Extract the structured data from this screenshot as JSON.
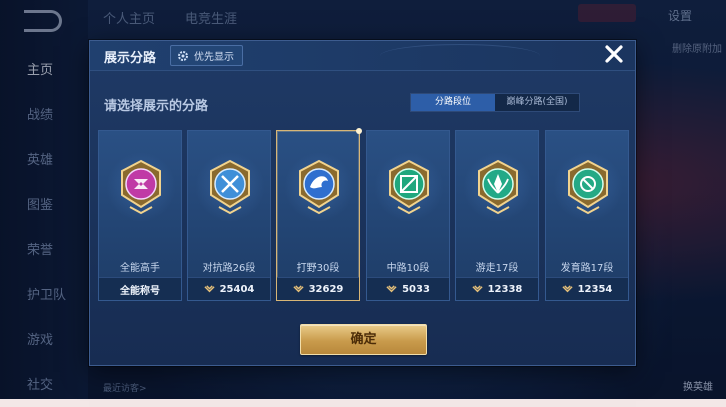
{
  "background": {
    "top_tabs": [
      "个人主页",
      "电竞生涯"
    ],
    "settings_label": "设置",
    "side_nav": [
      "主页",
      "战绩",
      "英雄",
      "图鉴",
      "荣誉",
      "护卫队",
      "游戏",
      "社交"
    ],
    "right_hint": "删除原附加",
    "swap_hero_label": "换英雄",
    "recent_visitors": "最近访客>"
  },
  "dialog": {
    "title": "展示分路",
    "priority_button": "优先显示",
    "prompt": "请选择展示的分路",
    "tabs": [
      {
        "label": "分路段位",
        "active": true
      },
      {
        "label": "巅峰分路(全国)",
        "active": false
      }
    ],
    "cards": [
      {
        "name": "全能高手",
        "footer": "全能称号",
        "score": null,
        "emblem": "all-round-emblem-icon",
        "color": "#c03aa6",
        "selected": false
      },
      {
        "name": "对抗路26段",
        "footer": null,
        "score": "25404",
        "emblem": "clash-lane-emblem-icon",
        "color": "#3f8fd8",
        "selected": false
      },
      {
        "name": "打野30段",
        "footer": null,
        "score": "32629",
        "emblem": "jungle-emblem-icon",
        "color": "#2f6fcf",
        "selected": true
      },
      {
        "name": "中路10段",
        "footer": null,
        "score": "5033",
        "emblem": "mid-lane-emblem-icon",
        "color": "#1fa77d",
        "selected": false
      },
      {
        "name": "游走17段",
        "footer": null,
        "score": "12338",
        "emblem": "roam-emblem-icon",
        "color": "#22a987",
        "selected": false
      },
      {
        "name": "发育路17段",
        "footer": null,
        "score": "12354",
        "emblem": "farm-lane-emblem-icon",
        "color": "#24a985",
        "selected": false
      }
    ],
    "confirm_button": "确定"
  },
  "colors": {
    "accent": "#2d5ea8",
    "gold": "#d8b676"
  }
}
